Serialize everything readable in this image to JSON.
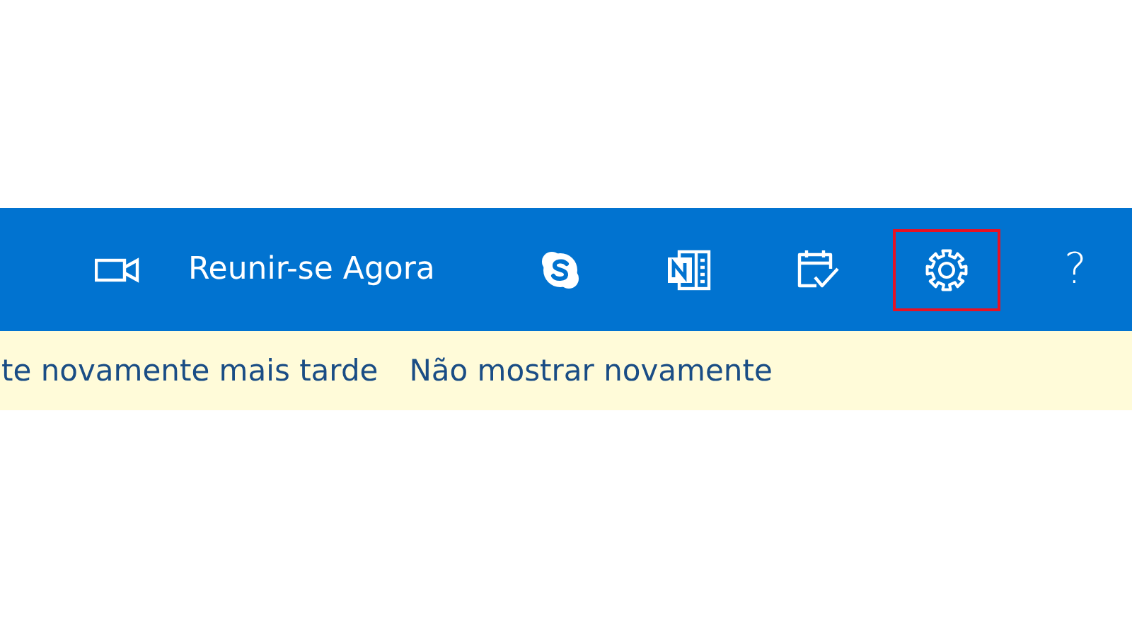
{
  "toolbar": {
    "items": [
      {
        "kind": "video",
        "highlighted": false
      },
      {
        "kind": "label",
        "label": "Reunir-se Agora",
        "highlighted": false
      },
      {
        "kind": "skype",
        "highlighted": false
      },
      {
        "kind": "onenote",
        "highlighted": false
      },
      {
        "kind": "calendar",
        "highlighted": false
      },
      {
        "kind": "settings",
        "highlighted": true
      },
      {
        "kind": "help",
        "label": "?",
        "highlighted": false
      }
    ]
  },
  "notice": {
    "message": "te novamente mais tarde",
    "link": "Não mostrar novamente"
  }
}
